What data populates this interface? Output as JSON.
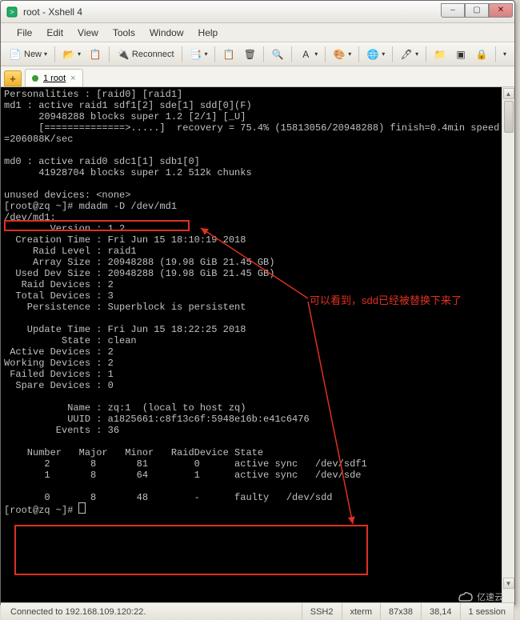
{
  "titlebar": {
    "icon": "terminal-icon",
    "title": "root - Xshell 4"
  },
  "winbtns": {
    "min": "–",
    "max": "▢",
    "close": "✕"
  },
  "menubar": [
    "File",
    "Edit",
    "View",
    "Tools",
    "Window",
    "Help"
  ],
  "toolbar": {
    "new_label": "New",
    "reconnect_label": "Reconnect"
  },
  "tabbar": {
    "add": "+",
    "tab1_label": "1 root",
    "tab1_close": "×"
  },
  "terminal": {
    "lines": [
      "Personalities : [raid0] [raid1]",
      "md1 : active raid1 sdf1[2] sde[1] sdd[0](F)",
      "      20948288 blocks super 1.2 [2/1] [_U]",
      "      [==============>.....]  recovery = 75.4% (15813056/20948288) finish=0.4min speed",
      "=206088K/sec",
      "",
      "md0 : active raid0 sdc1[1] sdb1[0]",
      "      41928704 blocks super 1.2 512k chunks",
      "",
      "unused devices: <none>",
      "[root@zq ~]# mdadm -D /dev/md1",
      "/dev/md1:",
      "        Version : 1.2",
      "  Creation Time : Fri Jun 15 18:10:19 2018",
      "     Raid Level : raid1",
      "     Array Size : 20948288 (19.98 GiB 21.45 GB)",
      "  Used Dev Size : 20948288 (19.98 GiB 21.45 GB)",
      "   Raid Devices : 2",
      "  Total Devices : 3",
      "    Persistence : Superblock is persistent",
      "",
      "    Update Time : Fri Jun 15 18:22:25 2018",
      "          State : clean",
      " Active Devices : 2",
      "Working Devices : 2",
      " Failed Devices : 1",
      "  Spare Devices : 0",
      "",
      "           Name : zq:1  (local to host zq)",
      "           UUID : a1825661:c8f13c6f:5948e16b:e41c6476",
      "         Events : 36",
      "",
      "    Number   Major   Minor   RaidDevice State",
      "       2       8       81        0      active sync   /dev/sdf1",
      "       1       8       64        1      active sync   /dev/sde",
      "",
      "       0       8       48        -      faulty   /dev/sdd",
      "[root@zq ~]# "
    ],
    "annotation": "可以看到，sdd已经被替换下来了"
  },
  "statusbar": {
    "left": "Connected to 192.168.109.120:22.",
    "proto": "SSH2",
    "term": "xterm",
    "size": "87x38",
    "pos": "38,14",
    "sess": "1 session"
  },
  "watermark": "亿速云"
}
